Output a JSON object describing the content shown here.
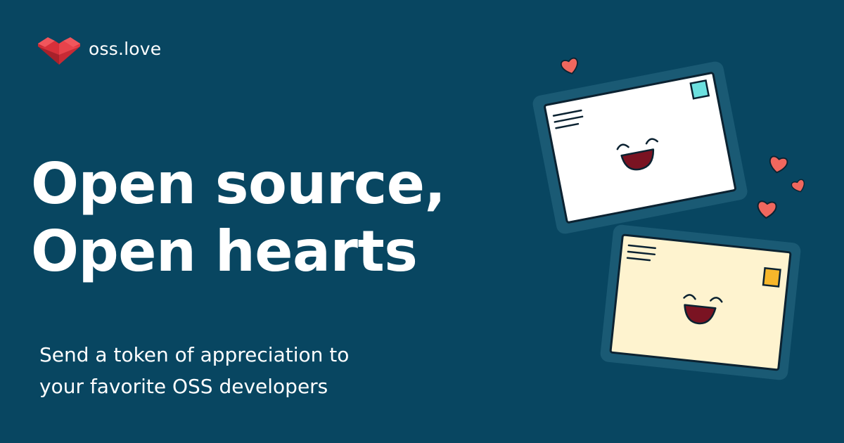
{
  "brand": {
    "name": "oss.love",
    "logo_icon": "heart-blocks-logo-icon",
    "logo_color": "#e0363f"
  },
  "headline": {
    "line1": "Open source,",
    "line2": "Open hearts"
  },
  "subtitle": {
    "line1": "Send a token of appreciation to",
    "line2": "your favorite OSS developers"
  },
  "illustration": {
    "envelope_top": {
      "paper_color": "#ffffff",
      "stamp_color": "#6ce0df"
    },
    "envelope_bottom": {
      "paper_color": "#fef3cf",
      "stamp_color": "#f7b72b"
    },
    "heart_color": "#f0675e",
    "mouth_color": "#7a1322"
  },
  "colors": {
    "background": "#084661",
    "text": "#ffffff",
    "card_frame": "#1a5a74",
    "outline": "#0b2231"
  }
}
